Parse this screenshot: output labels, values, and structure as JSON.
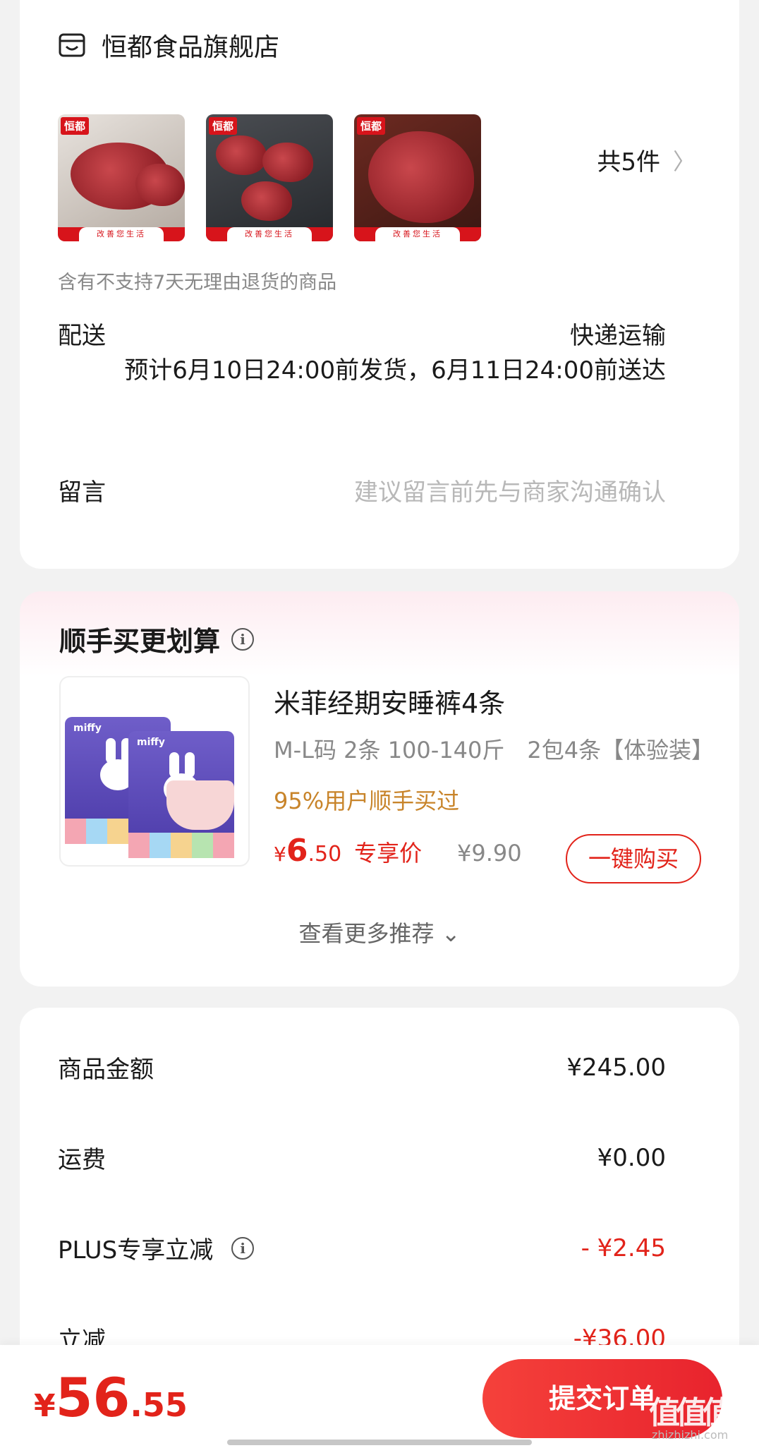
{
  "store": {
    "name": "恒都食品旗舰店",
    "item_count": "共5件",
    "thumb_brand": "恒都",
    "thumb_strip": "改善您生活",
    "return_note": "含有不支持7天无理由退货的商品"
  },
  "delivery": {
    "label": "配送",
    "method": "快递运输",
    "eta": "预计6月10日24:00前发货，6月11日24:00前送达"
  },
  "remark": {
    "label": "留言",
    "placeholder": "建议留言前先与商家沟通确认"
  },
  "recommend": {
    "title": "顺手买更划算",
    "product": {
      "pack_brand": "miffy",
      "name": "米菲经期安睡裤4条",
      "spec": "M-L码 2条 100-140斤　2包4条【体验装】",
      "social_proof": "95%用户顺手买过",
      "price_currency": "¥",
      "price_int": "6",
      "price_dec": ".50",
      "price_tag": "专享价",
      "original_price": "¥9.90",
      "buy_label": "一键购买"
    },
    "more_label": "查看更多推荐"
  },
  "summary": {
    "rows": [
      {
        "label": "商品金额",
        "value": "¥245.00"
      },
      {
        "label": "运费",
        "value": "¥0.00"
      },
      {
        "label": "PLUS专享立减",
        "value": "- ¥2.45"
      },
      {
        "label": "立减",
        "value": "-¥36.00"
      }
    ]
  },
  "footer": {
    "total_currency": "¥",
    "total_int": "56",
    "total_dec": ".55",
    "submit_label": "提交订单",
    "watermark": "值值值",
    "watermark_url": "zhizhizhi.com"
  },
  "colors": {
    "accent_red": "#e2231a",
    "social_proof": "#c8842a",
    "background": "#f2f2f2"
  }
}
